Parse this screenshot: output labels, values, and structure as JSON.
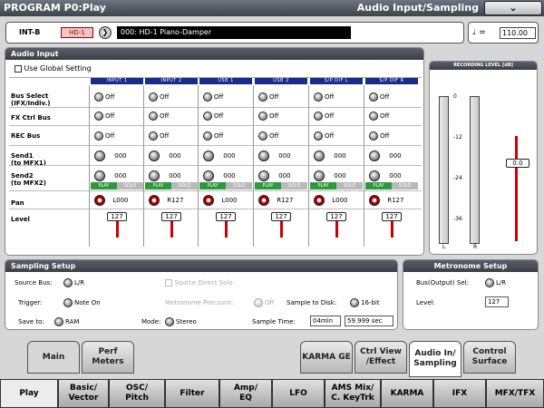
{
  "title": {
    "left": "PROGRAM P0:Play",
    "right": "Audio Input/Sampling"
  },
  "header": {
    "bank": "INT-B",
    "badge": "HD-1",
    "program": "000: HD-1 Piano-Damper",
    "tempo_symbol": "♩ =",
    "tempo": "110.00"
  },
  "audio_input": {
    "heading": "Audio Input",
    "use_global": "Use Global Setting",
    "rows": [
      "Bus Select\n(IFX/Indiv.)",
      "FX Ctrl Bus",
      "REC Bus",
      "Send1\n(to MFX1)",
      "Send2\n(to MFX2)",
      "Pan",
      "Level"
    ],
    "channels": [
      {
        "name": "INPUT 1",
        "bus": "Off",
        "fx": "Off",
        "rec": "Off",
        "send1": "000",
        "send2": "000",
        "pan": "L000",
        "level": "127"
      },
      {
        "name": "INPUT 2",
        "bus": "Off",
        "fx": "Off",
        "rec": "Off",
        "send1": "000",
        "send2": "000",
        "pan": "R127",
        "level": "127"
      },
      {
        "name": "USB 1",
        "bus": "Off",
        "fx": "Off",
        "rec": "Off",
        "send1": "000",
        "send2": "000",
        "pan": "L000",
        "level": "127"
      },
      {
        "name": "USB 2",
        "bus": "Off",
        "fx": "Off",
        "rec": "Off",
        "send1": "000",
        "send2": "000",
        "pan": "R127",
        "level": "127"
      },
      {
        "name": "S/P DIF L",
        "bus": "Off",
        "fx": "Off",
        "rec": "Off",
        "send1": "000",
        "send2": "000",
        "pan": "L000",
        "level": "127"
      },
      {
        "name": "S/P DIF R",
        "bus": "Off",
        "fx": "Off",
        "rec": "Off",
        "send1": "000",
        "send2": "000",
        "pan": "R127",
        "level": "127"
      }
    ],
    "play": "PLAY",
    "solo": "SOLO"
  },
  "rec_level": {
    "heading": "RECORDING LEVEL [dB]",
    "ticks": [
      "0",
      "-12",
      "-24",
      "-36"
    ],
    "l": "L",
    "r": "R",
    "value": "0.0"
  },
  "sampling": {
    "heading": "Sampling Setup",
    "source_bus_label": "Source Bus:",
    "source_bus": "L/R",
    "source_direct_solo": "Source Direct Solo",
    "trigger_label": "Trigger:",
    "trigger": "Note On",
    "metronome_label": "Metronome Precount:",
    "metronome": "Off",
    "sample_disk_label": "Sample to Disk:",
    "sample_disk": "16-bit",
    "save_label": "Save to:",
    "save": "RAM",
    "mode_label": "Mode:",
    "mode": "Stereo",
    "time_label": "Sample Time:",
    "time_min": "04min",
    "time_sec": "59.999 sec"
  },
  "metronome": {
    "heading": "Metronome Setup",
    "bus_label": "Bus(Output) Sel:",
    "bus": "L/R",
    "level_label": "Level:",
    "level": "127"
  },
  "page_tabs": [
    {
      "label": "Main"
    },
    {
      "label": "Perf\nMeters"
    },
    {
      "label": "KARMA GE"
    },
    {
      "label": "Ctrl View\n/Effect"
    },
    {
      "label": "Audio In/\nSampling"
    },
    {
      "label": "Control\nSurface"
    }
  ],
  "bottom_tabs": [
    {
      "label": "Play"
    },
    {
      "label": "Basic/\nVector"
    },
    {
      "label": "OSC/\nPitch"
    },
    {
      "label": "Filter"
    },
    {
      "label": "Amp/\nEQ"
    },
    {
      "label": "LFO"
    },
    {
      "label": "AMS Mix/\nC. KeyTrk"
    },
    {
      "label": "KARMA"
    },
    {
      "label": "IFX"
    },
    {
      "label": "MFX/TFX"
    }
  ]
}
